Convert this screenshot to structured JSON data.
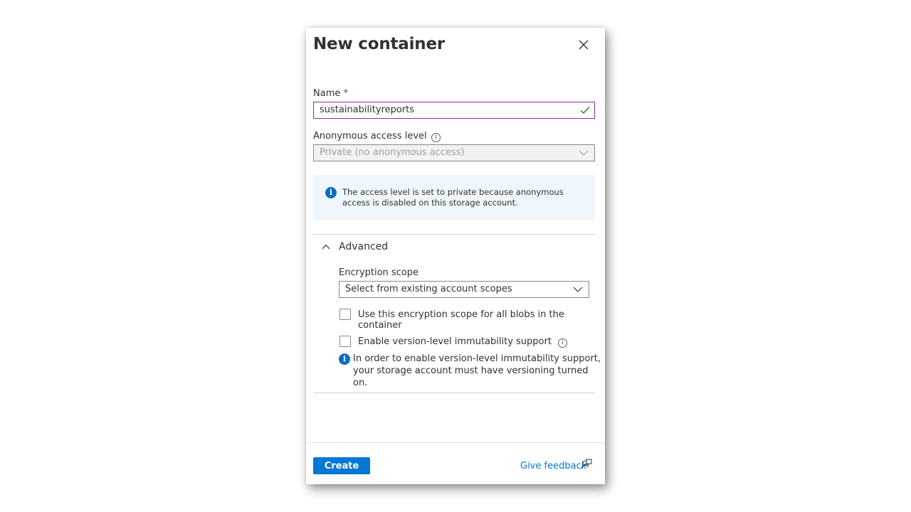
{
  "dialog": {
    "title": "New container",
    "name_label": "Name",
    "required_marker": "*",
    "name_value": "sustainabilityreports",
    "access_label": "Anonymous access level",
    "access_value": "Private (no anonymous access)",
    "info_message": "The access level is set to private because anonymous access is disabled on this storage account.",
    "advanced": {
      "label": "Advanced",
      "expanded": true,
      "encryption_label": "Encryption scope",
      "encryption_placeholder": "Select from existing account scopes",
      "use_scope_checkbox": "Use this encryption scope for all blobs in the container",
      "immutability_checkbox": "Enable version-level immutability support",
      "immutability_note": "In order to enable version-level immutability support, your storage account must have versioning turned on."
    },
    "footer": {
      "create_label": "Create",
      "feedback_label": "Give feedback"
    }
  },
  "icons": {
    "close": "close-icon",
    "valid": "checkmark-icon",
    "info": "info-icon",
    "dropdown": "chevron-down-icon",
    "collapse": "chevron-up-icon",
    "feedback": "feedback-icon"
  },
  "colors": {
    "accent": "#0078d4",
    "focus_border": "#8a2da5",
    "valid": "#107c10",
    "required": "#a4262c",
    "info_background": "#eff6fc"
  }
}
